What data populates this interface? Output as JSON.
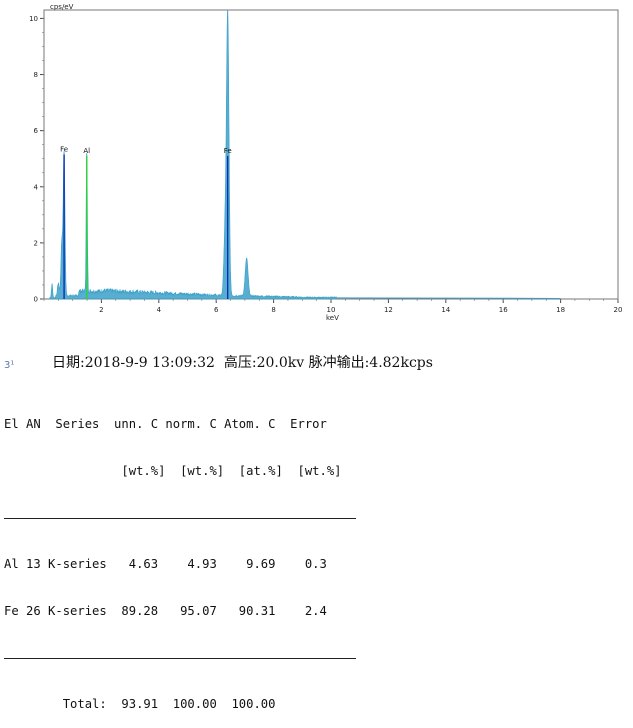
{
  "chart_data": {
    "type": "line",
    "ylabel": "cps/eV",
    "xlabel": "keV",
    "xlim": [
      0,
      20
    ],
    "ylim": [
      0,
      10.3
    ],
    "x_ticks": [
      2,
      4,
      6,
      8,
      10,
      12,
      14,
      16,
      18,
      20
    ],
    "y_ticks": [
      0,
      2,
      4,
      6,
      8,
      10
    ],
    "spectrum_peaks": [
      {
        "x": 0.7,
        "y": 5.2,
        "w": 0.03
      },
      {
        "x": 0.62,
        "y": 1.9,
        "w": 0.03
      },
      {
        "x": 0.5,
        "y": 0.45,
        "w": 0.03
      },
      {
        "x": 0.28,
        "y": 0.5,
        "w": 0.02
      },
      {
        "x": 1.49,
        "y": 5.1,
        "w": 0.02
      },
      {
        "x": 6.4,
        "y": 10.2,
        "w": 0.045
      },
      {
        "x": 6.3,
        "y": 1.9,
        "w": 0.04
      },
      {
        "x": 7.06,
        "y": 1.35,
        "w": 0.05
      }
    ],
    "element_lines": [
      {
        "label": "Fe",
        "x": 0.7,
        "y": 5.15,
        "color": "#0a2fb8"
      },
      {
        "label": "Al",
        "x": 1.49,
        "y": 5.1,
        "color": "#2fd23a"
      },
      {
        "label": "Fe",
        "x": 6.4,
        "y": 5.1,
        "color": "#0a2fb8"
      }
    ],
    "spectrum_color": "#3aa0c8"
  },
  "info": {
    "mark": "3¹",
    "line": "日期:2018-9-9 13:09:32  高压:20.0kv 脉冲输出:4.82kcps"
  },
  "table": {
    "header1": "El AN  Series  unn. C norm. C Atom. C  Error",
    "header2": "                [wt.%]  [wt.%]  [at.%]  [wt.%]",
    "rows": [
      "Al 13 K-series   4.63    4.93    9.69    0.3",
      "Fe 26 K-series  89.28   95.07   90.31    2.4"
    ],
    "total": "        Total:  93.91  100.00  100.00"
  }
}
